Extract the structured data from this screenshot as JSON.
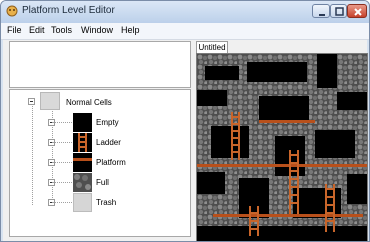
{
  "window": {
    "title": "Platform Level Editor",
    "controls": {
      "minimize": "minimize",
      "maximize": "maximize",
      "close": "close"
    }
  },
  "menu": [
    {
      "label": "File"
    },
    {
      "label": "Edit"
    },
    {
      "label": "Tools"
    },
    {
      "label": "Window"
    },
    {
      "label": "Help"
    }
  ],
  "tree": {
    "root": "Normal Cells",
    "children": [
      {
        "label": "Empty"
      },
      {
        "label": "Ladder"
      },
      {
        "label": "Platform"
      },
      {
        "label": "Full"
      },
      {
        "label": "Trash"
      }
    ]
  },
  "editor": {
    "tab": "Untitled"
  },
  "colors": {
    "stone": "#5a5a5a",
    "stone_dark": "#2f2f2f",
    "ladder": "#c8652a",
    "platform": "#b8501b",
    "trash": "#d6d6d6"
  }
}
